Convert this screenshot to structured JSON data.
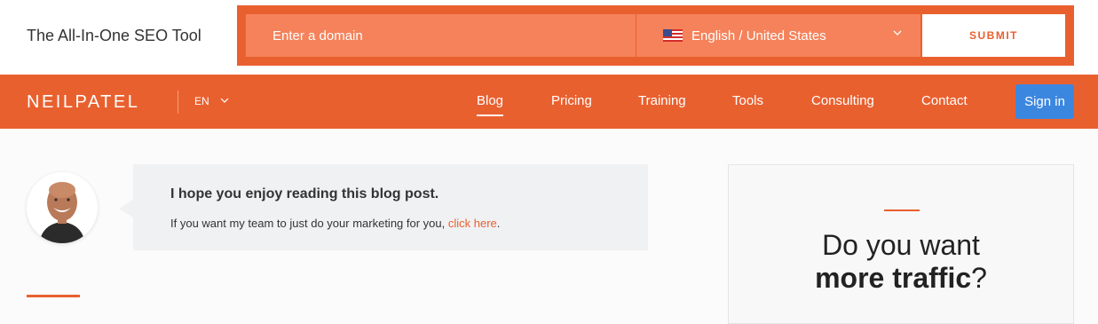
{
  "seo_bar": {
    "title": "The All-In-One SEO Tool",
    "domain_placeholder": "Enter a domain",
    "language": "English / United States",
    "submit_label": "SUBMIT"
  },
  "nav": {
    "logo": "NEILPATEL",
    "lang": "EN",
    "links": [
      {
        "label": "Blog",
        "active": true
      },
      {
        "label": "Pricing"
      },
      {
        "label": "Training"
      },
      {
        "label": "Tools"
      },
      {
        "label": "Consulting"
      },
      {
        "label": "Contact"
      }
    ],
    "signin_label": "Sign in"
  },
  "callout": {
    "title": "I hope you enjoy reading this blog post.",
    "text": "If you want my team to just do your marketing for you, ",
    "link": "click here",
    "suffix": "."
  },
  "sidebar": {
    "line1": "Do you want",
    "line2_bold": "more traffic",
    "line2_suffix": "?"
  },
  "colors": {
    "brand": "#e9602f",
    "signin": "#3b87e0"
  }
}
